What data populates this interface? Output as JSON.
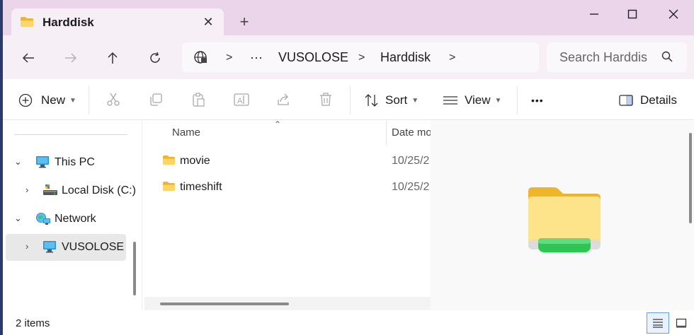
{
  "window": {
    "tab_title": "Harddisk",
    "new_tab_label": "+"
  },
  "address": {
    "more_label": "···",
    "crumbs": [
      "VUSOLOSE",
      "Harddisk"
    ]
  },
  "search": {
    "placeholder": "Search Harddis"
  },
  "toolbar": {
    "new_label": "New",
    "sort_label": "Sort",
    "view_label": "View",
    "more_label": "•••",
    "details_label": "Details"
  },
  "sidebar": {
    "items": [
      {
        "label": "This PC"
      },
      {
        "label": "Local Disk (C:)"
      },
      {
        "label": "Network"
      },
      {
        "label": "VUSOLOSE"
      }
    ]
  },
  "filelist": {
    "columns": {
      "name": "Name",
      "date": "Date mo"
    },
    "rows": [
      {
        "name": "movie",
        "date": "10/25/2"
      },
      {
        "name": "timeshift",
        "date": "10/25/2"
      }
    ]
  },
  "status": {
    "items_count": "2 items"
  },
  "colors": {
    "title_bg": "#ead5ea",
    "nav_bg": "#f6eff6",
    "folder_yellow": "#f7c948",
    "drive_green": "#2dc653",
    "selection": "#e8e8e8"
  }
}
